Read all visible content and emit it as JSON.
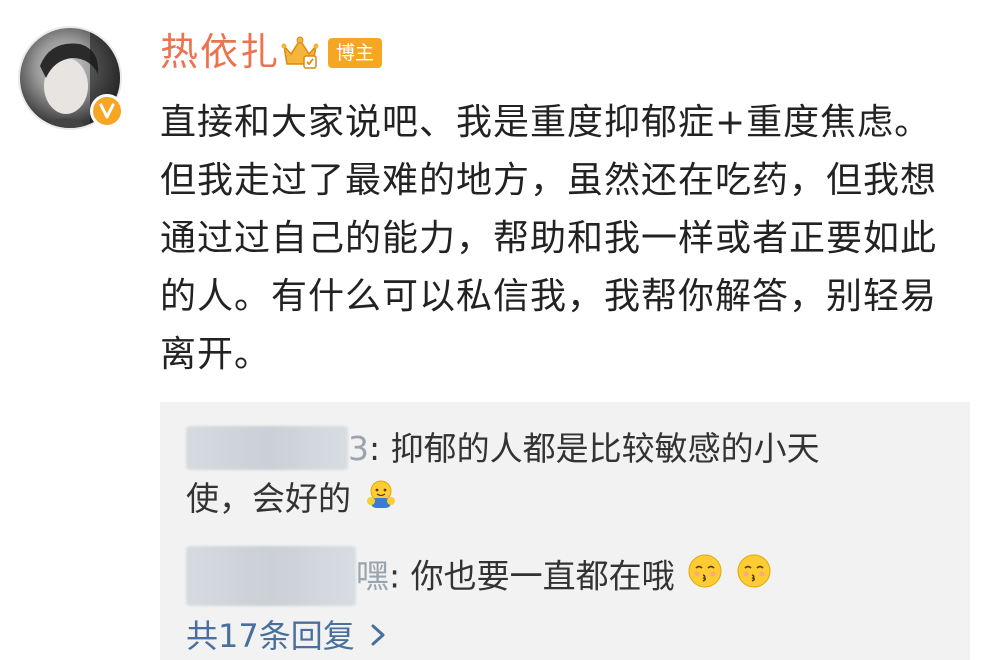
{
  "post": {
    "username": "热依扎",
    "badge_label": "博主",
    "text": "直接和大家说吧、我是重度抑郁症+重度焦虑。但我走过了最难的地方，虽然还在吃药，但我想通过过自己的能力，帮助和我一样或者正要如此的人。有什么可以私信我，我帮你解答，别轻易离开。"
  },
  "comments": [
    {
      "name_tail": "3",
      "text_line1": ": 抑郁的人都是比较敏感的小天",
      "text_line2": "使，会好的",
      "emoji": "hug-emoji"
    },
    {
      "name_tail": "嘿",
      "text": ": 你也要一直都在哦",
      "emoji": "kiss-emoji"
    }
  ],
  "replies": {
    "label": "共17条回复"
  },
  "colors": {
    "username": "#eb7350",
    "badge": "#f6a623",
    "link": "#4a6f9c",
    "comment_bg": "#f2f2f2"
  }
}
